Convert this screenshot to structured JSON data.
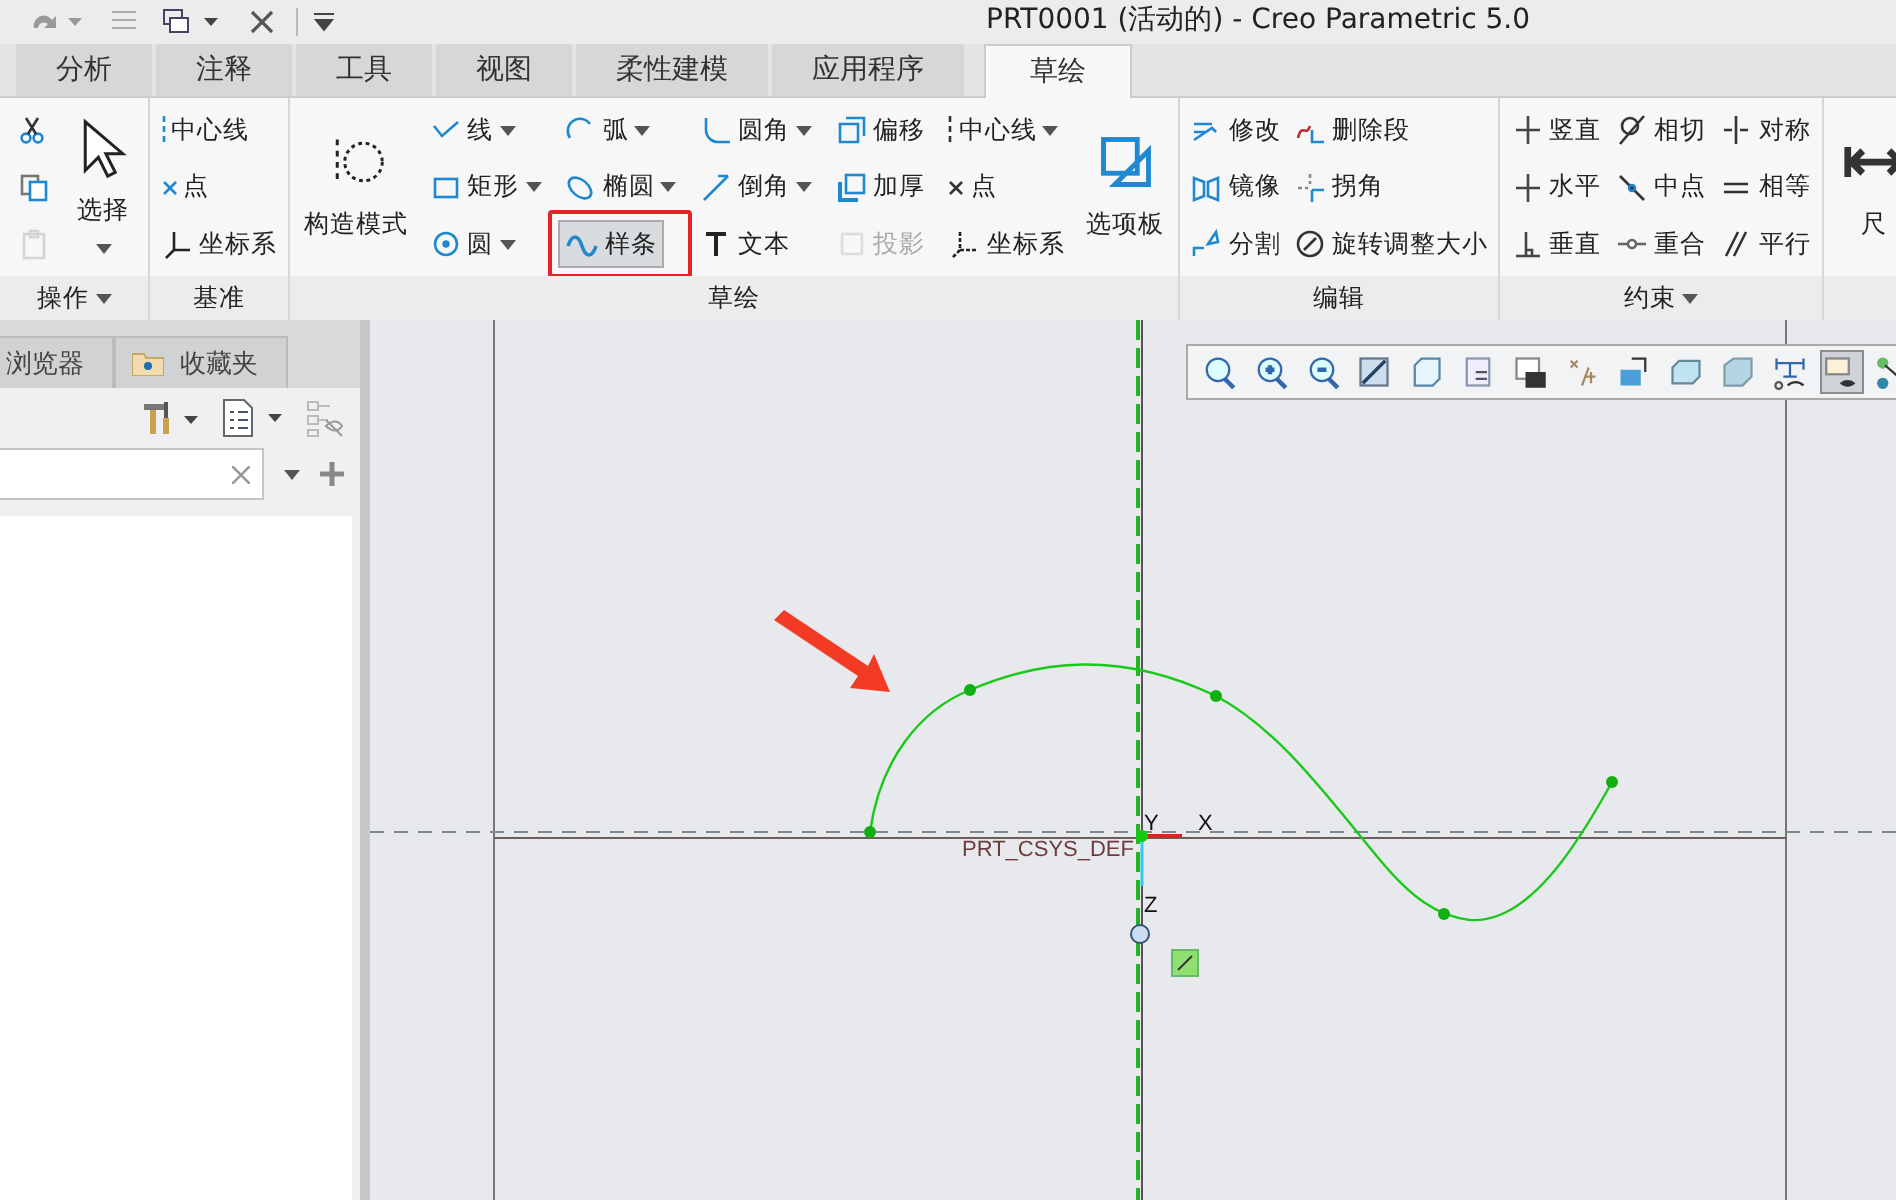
{
  "window": {
    "title": "PRT0001 (活动的) - Creo Parametric 5.0"
  },
  "tabs": [
    {
      "label": "分析",
      "selected": false
    },
    {
      "label": "注释",
      "selected": false
    },
    {
      "label": "工具",
      "selected": false
    },
    {
      "label": "视图",
      "selected": false
    },
    {
      "label": "柔性建模",
      "selected": false
    },
    {
      "label": "应用程序",
      "selected": false
    },
    {
      "label": "草绘",
      "selected": true
    }
  ],
  "ribbon": {
    "groups": [
      {
        "label": "操作",
        "dropdown": true,
        "columns": [
          {
            "kind": "small",
            "items": [
              {
                "dropdown": false,
                "selected": false,
                "disabled": false
              },
              {
                "dropdown": false,
                "selected": false,
                "disabled": false
              },
              {
                "dropdown": false,
                "selected": false,
                "disabled": true
              }
            ]
          },
          {
            "kind": "large",
            "items": [
              {
                "label": "选择",
                "dropdown": true,
                "selected": false,
                "disabled": false
              }
            ]
          }
        ]
      },
      {
        "label": "基准",
        "dropdown": false,
        "columns": [
          {
            "kind": "small",
            "items": [
              {
                "label": "中心线",
                "dropdown": false,
                "selected": false,
                "disabled": false
              },
              {
                "label": "点",
                "dropdown": false,
                "selected": false,
                "disabled": false
              },
              {
                "label": "坐标系",
                "dropdown": false,
                "selected": false,
                "disabled": false
              }
            ]
          }
        ]
      },
      {
        "label": "草绘",
        "dropdown": false,
        "columns": [
          {
            "kind": "large",
            "items": [
              {
                "label": "构造模式",
                "dropdown": false,
                "selected": false,
                "disabled": false
              }
            ]
          },
          {
            "kind": "small",
            "items": [
              {
                "label": "线",
                "dropdown": true,
                "selected": false,
                "disabled": false
              },
              {
                "label": "矩形",
                "dropdown": true,
                "selected": false,
                "disabled": false
              },
              {
                "label": "圆",
                "dropdown": true,
                "selected": false,
                "disabled": false
              }
            ]
          },
          {
            "kind": "small",
            "items": [
              {
                "label": "弧",
                "dropdown": true,
                "selected": false,
                "disabled": false
              },
              {
                "label": "椭圆",
                "dropdown": true,
                "selected": false,
                "disabled": false
              },
              {
                "label": "样条",
                "dropdown": false,
                "selected": true,
                "disabled": false
              }
            ]
          },
          {
            "kind": "small",
            "items": [
              {
                "label": "圆角",
                "dropdown": true,
                "selected": false,
                "disabled": false
              },
              {
                "label": "倒角",
                "dropdown": true,
                "selected": false,
                "disabled": false
              },
              {
                "label": "文本",
                "dropdown": false,
                "selected": false,
                "disabled": false
              }
            ]
          },
          {
            "kind": "small",
            "items": [
              {
                "label": "偏移",
                "dropdown": false,
                "selected": false,
                "disabled": false
              },
              {
                "label": "加厚",
                "dropdown": false,
                "selected": false,
                "disabled": false
              },
              {
                "label": "投影",
                "dropdown": false,
                "selected": false,
                "disabled": true
              }
            ]
          },
          {
            "kind": "small",
            "items": [
              {
                "label": "中心线",
                "dropdown": true,
                "selected": false,
                "disabled": false
              },
              {
                "label": "点",
                "dropdown": false,
                "selected": false,
                "disabled": false
              },
              {
                "label": "坐标系",
                "dropdown": false,
                "selected": false,
                "disabled": false
              }
            ]
          },
          {
            "kind": "large",
            "items": [
              {
                "label": "选项板",
                "dropdown": false,
                "selected": false,
                "disabled": false
              }
            ]
          }
        ]
      },
      {
        "label": "编辑",
        "dropdown": false,
        "columns": [
          {
            "kind": "small",
            "items": [
              {
                "label": "修改",
                "dropdown": false,
                "selected": false,
                "disabled": false
              },
              {
                "label": "镜像",
                "dropdown": false,
                "selected": false,
                "disabled": false
              },
              {
                "label": "分割",
                "dropdown": false,
                "selected": false,
                "disabled": false
              }
            ]
          },
          {
            "kind": "small",
            "items": [
              {
                "label": "删除段",
                "dropdown": false,
                "selected": false,
                "disabled": false
              },
              {
                "label": "拐角",
                "dropdown": false,
                "selected": false,
                "disabled": false
              },
              {
                "label": "旋转调整大小",
                "dropdown": false,
                "selected": false,
                "disabled": false
              }
            ]
          }
        ]
      },
      {
        "label": "约束",
        "dropdown": true,
        "columns": [
          {
            "kind": "small",
            "items": [
              {
                "label": "竖直",
                "dropdown": false,
                "selected": false,
                "disabled": false
              },
              {
                "label": "水平",
                "dropdown": false,
                "selected": false,
                "disabled": false
              },
              {
                "label": "垂直",
                "dropdown": false,
                "selected": false,
                "disabled": false
              }
            ]
          },
          {
            "kind": "small",
            "items": [
              {
                "label": "相切",
                "dropdown": false,
                "selected": false,
                "disabled": false
              },
              {
                "label": "中点",
                "dropdown": false,
                "selected": false,
                "disabled": false
              },
              {
                "label": "重合",
                "dropdown": false,
                "selected": false,
                "disabled": false
              }
            ]
          },
          {
            "kind": "small",
            "items": [
              {
                "label": "对称",
                "dropdown": false,
                "selected": false,
                "disabled": false
              },
              {
                "label": "相等",
                "dropdown": false,
                "selected": false,
                "disabled": false
              },
              {
                "label": "平行",
                "dropdown": false,
                "selected": false,
                "disabled": false
              }
            ]
          }
        ]
      },
      {
        "columns": [
          {
            "kind": "large",
            "items": [
              {
                "label": "尺",
                "dropdown": false,
                "selected": false,
                "disabled": false
              }
            ]
          }
        ]
      }
    ]
  },
  "side_panel": {
    "tabs": [
      {
        "label": "浏览器",
        "selected": false
      },
      {
        "label": "收藏夹",
        "selected": false
      }
    ]
  },
  "view_toolbar": {
    "buttons": [
      {
        "selected": false
      },
      {
        "selected": false
      },
      {
        "selected": false
      },
      {
        "selected": false
      },
      {
        "selected": false
      },
      {
        "selected": false
      },
      {
        "selected": false
      },
      {
        "selected": false
      },
      {
        "selected": false
      },
      {
        "selected": false
      },
      {
        "selected": false
      },
      {
        "selected": false
      },
      {
        "selected": true
      },
      {
        "selected": false
      }
    ]
  },
  "sketch": {
    "csys_label": "PRT_CSYS_DEF",
    "axis_labels": [
      "Y",
      "X",
      "Z"
    ]
  }
}
